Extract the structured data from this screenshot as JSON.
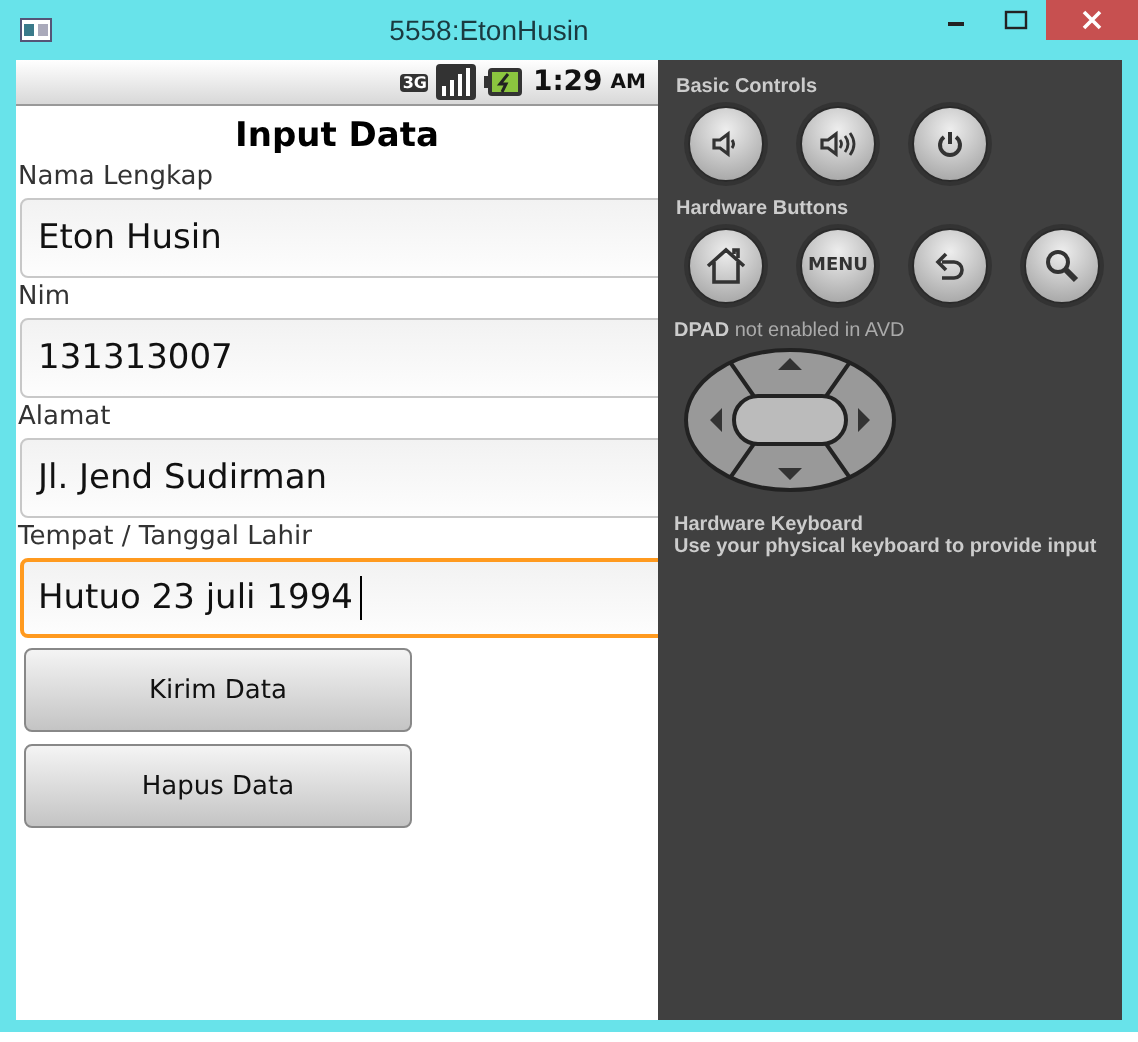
{
  "window": {
    "title": "5558:EtonHusin"
  },
  "status_bar": {
    "network": "3G",
    "time": "1:29",
    "meridiem": "AM"
  },
  "form": {
    "title": "Input Data",
    "fields": [
      {
        "label": "Nama Lengkap",
        "value": "Eton Husin",
        "focused": false
      },
      {
        "label": "Nim",
        "value": "131313007",
        "focused": false
      },
      {
        "label": "Alamat",
        "value": "Jl. Jend Sudirman",
        "focused": false
      },
      {
        "label": "Tempat / Tanggal Lahir",
        "value": "Hutuo 23 juli 1994",
        "focused": true
      }
    ],
    "buttons": [
      "Kirim Data",
      "Hapus Data"
    ]
  },
  "controls": {
    "basic": {
      "title": "Basic Controls",
      "buttons": [
        {
          "kind": "volume-down"
        },
        {
          "kind": "volume-up"
        },
        {
          "kind": "power"
        }
      ]
    },
    "hardware": {
      "title": "Hardware Buttons",
      "buttons": [
        {
          "kind": "home"
        },
        {
          "kind": "menu",
          "label": "MENU"
        },
        {
          "kind": "back"
        },
        {
          "kind": "search"
        }
      ]
    },
    "dpad": {
      "note": "**DPAD** not enabled in AVD"
    },
    "keyboard": {
      "title": "Hardware Keyboard",
      "text": "Use your physical keyboard to provide input"
    }
  }
}
